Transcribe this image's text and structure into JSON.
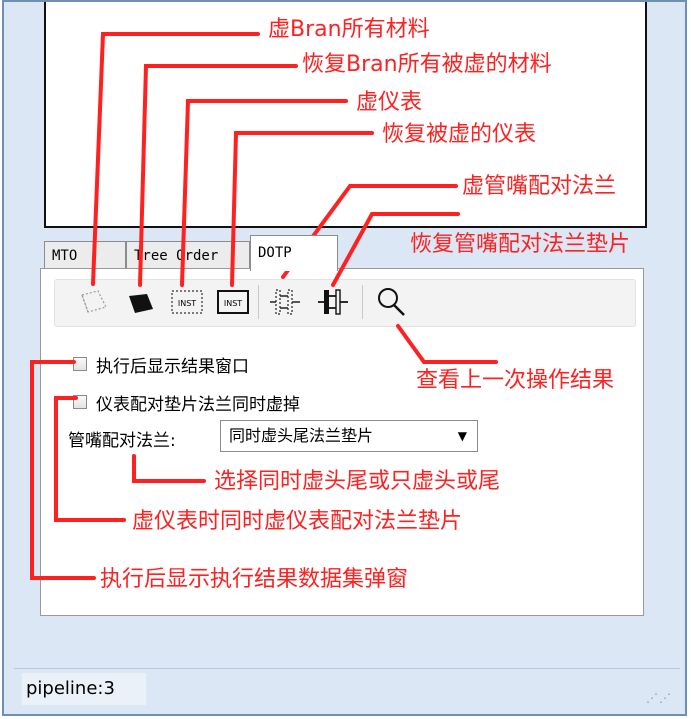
{
  "tabs": [
    {
      "label": "MTO"
    },
    {
      "label": "Tree Order"
    },
    {
      "label": "DOTP",
      "active": true
    }
  ],
  "toolbar": {
    "buttons": [
      {
        "icon": "dim-outline-icon",
        "meaning": "虚Bran所有材料"
      },
      {
        "icon": "solid-shape-icon",
        "meaning": "恢复Bran所有被虚的材料"
      },
      {
        "icon": "inst-dotted-icon",
        "text": "INST",
        "meaning": "虚仪表"
      },
      {
        "icon": "inst-solid-icon",
        "text": "INST",
        "meaning": "恢复被虚的仪表"
      },
      {
        "icon": "flange-dotted-icon",
        "meaning": "虚管嘴配对法兰"
      },
      {
        "icon": "flange-solid-icon",
        "meaning": "恢复管嘴配对法兰垫片"
      },
      {
        "icon": "magnifier-icon",
        "meaning": "查看上一次操作结果"
      }
    ]
  },
  "options": {
    "show_result_window": {
      "label": "执行后显示结果窗口",
      "checked": false
    },
    "dim_instrument_flange": {
      "label": "仪表配对垫片法兰同时虚掉",
      "checked": false
    },
    "nozzle_flange": {
      "label": "管嘴配对法兰:",
      "selected": "同时虚头尾法兰垫片"
    }
  },
  "status": {
    "text": "pipeline:3"
  },
  "annotations": [
    "虚Bran所有材料",
    "恢复Bran所有被虚的材料",
    "虚仪表",
    "恢复被虚的仪表",
    "虚管嘴配对法兰",
    "恢复管嘴配对法兰垫片",
    "查看上一次操作结果",
    "选择同时虚头尾或只虚头或尾",
    "虚仪表时同时虚仪表配对法兰垫片",
    "执行后显示执行结果数据集弹窗"
  ],
  "colors": {
    "annotation": "#ff2020",
    "frame_bg": "#dbe7f5"
  }
}
